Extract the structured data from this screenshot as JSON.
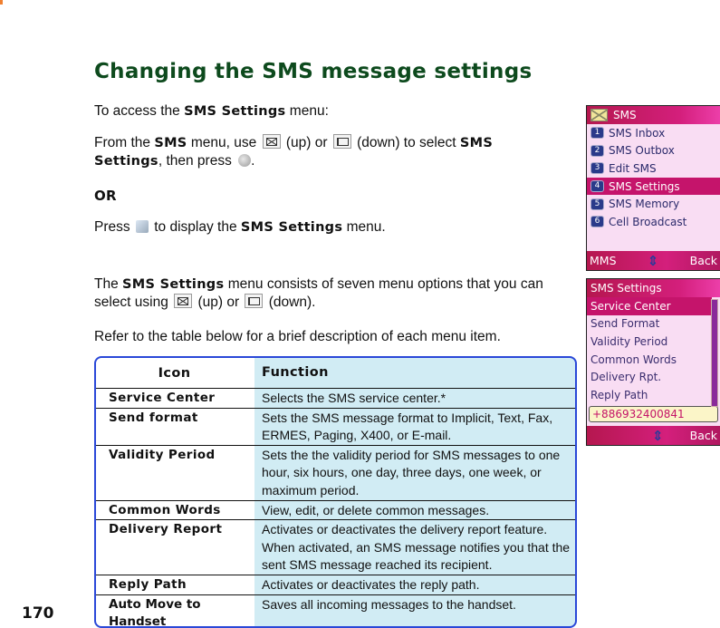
{
  "heading": "Changing the SMS message settings",
  "intro": {
    "prefix": "To access the ",
    "bold": "SMS Settings",
    "suffix": " menu:"
  },
  "step1": {
    "t1": "From the ",
    "b1": "SMS",
    "t2": " menu, use ",
    "up_icon": "envelope-key-icon",
    "t3": " (up) or ",
    "down_icon": "down-key-icon",
    "t4": " (down) to select ",
    "b2": "SMS Settings",
    "t5": ", then press ",
    "press_icon": "center-key-icon",
    "t6": "."
  },
  "or_label": "OR",
  "step2": {
    "t1": "Press ",
    "key_icon": "menu-key-icon",
    "t2": " to display the ",
    "b1": "SMS Settings",
    "t3": " menu."
  },
  "para2": {
    "t1": "The ",
    "b1": "SMS Settings",
    "t2": " menu consists of seven menu options that you can select using ",
    "t3": " (up) or ",
    "t4": " (down)."
  },
  "para3": "Refer to the table below for a brief description of each menu item.",
  "table": {
    "headers": [
      "Icon",
      "Function"
    ],
    "rows": [
      {
        "name": "Service Center",
        "desc": "Selects the SMS service center.*"
      },
      {
        "name": "Send format",
        "desc": "Sets the SMS message format to Implicit, Text, Fax, ERMES, Paging, X400, or E-mail."
      },
      {
        "name": "Validity Period",
        "desc": "Sets the the validity period for SMS messages to one hour, six hours, one day, three days, one week, or maximum period."
      },
      {
        "name": "Common Words",
        "desc": "View, edit, or delete common messages."
      },
      {
        "name": "Delivery Report",
        "desc": "Activates or deactivates the delivery report feature. When activated, an SMS message notifies you that the sent SMS message reached its recipient."
      },
      {
        "name": "Reply Path",
        "desc": "Activates or deactivates the reply path."
      },
      {
        "name": "Auto Move to Handset",
        "desc": "Saves all incoming messages to the handset."
      }
    ]
  },
  "phone1": {
    "title": "SMS",
    "items": [
      {
        "num": "1",
        "label": "SMS  Inbox"
      },
      {
        "num": "2",
        "label": "SMS  Outbox"
      },
      {
        "num": "3",
        "label": "Edit  SMS"
      },
      {
        "num": "4",
        "label": "SMS  Settings"
      },
      {
        "num": "5",
        "label": "SMS  Memory"
      },
      {
        "num": "6",
        "label": "Cell  Broadcast"
      }
    ],
    "selected_index": 3,
    "left_soft": "MMS",
    "right_soft": "Back",
    "nav_icon": "⇕"
  },
  "phone2": {
    "title": "SMS  Settings",
    "items": [
      "Service  Center",
      "Send  Format",
      "Validity  Period",
      "Common  Words",
      "Delivery  Rpt.",
      "Reply  Path"
    ],
    "selected_index": 0,
    "number": "+886932400841",
    "right_soft": "Back",
    "nav_icon": "⇕"
  },
  "page_number": "170",
  "colors": {
    "heading": "#0d4a1d",
    "table_border": "#2a48d8",
    "table_function_bg": "#d1ecf4",
    "phone_accent": "#c5146b",
    "phone_bg": "#f9ddf3"
  }
}
